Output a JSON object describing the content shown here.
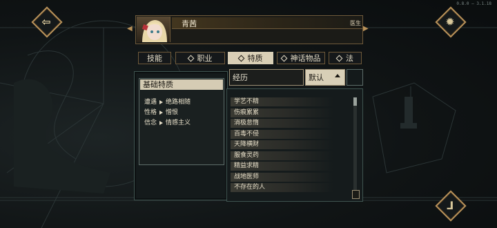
{
  "version": "0.8.0 — 3.1.18",
  "nav": {
    "back_icon": "back-arrow-icon",
    "settings_icon": "gear-icon",
    "confirm_icon": "boot-icon"
  },
  "character": {
    "name": "青茜",
    "job": "医生"
  },
  "tabs": [
    {
      "label": "技能",
      "active": false
    },
    {
      "label": "职业",
      "active": false
    },
    {
      "label": "特质",
      "active": true
    },
    {
      "label": "神话物品",
      "active": false
    },
    {
      "label": "法",
      "active": false
    }
  ],
  "basic_traits": {
    "title": "基础特质",
    "rows": [
      {
        "key": "遭遇",
        "value": "绝路相随"
      },
      {
        "key": "性格",
        "value": "憎恨"
      },
      {
        "key": "信念",
        "value": "情感主义"
      }
    ]
  },
  "list_header": {
    "experience_label": "经历",
    "sort_label": "默认"
  },
  "traits": [
    "学艺不精",
    "伤痕累累",
    "消极怠惰",
    "百毒不侵",
    "天降横财",
    "服食灵药",
    "精益求精",
    "战地医师",
    "不存在的人"
  ],
  "colors": {
    "accent_gold": "#b9925a",
    "active_tab": "#d9cfb6",
    "panel_border": "#3f5450"
  }
}
